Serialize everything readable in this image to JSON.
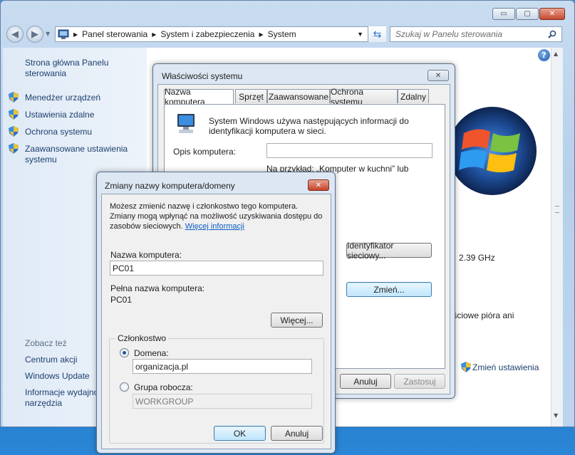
{
  "explorer": {
    "title_buttons": {
      "minimize": "▭",
      "maximize": "▢",
      "close": "✕"
    },
    "breadcrumb": [
      "Panel sterowania",
      "System i zabezpieczenia",
      "System"
    ],
    "search_placeholder": "Szukaj w Panelu sterowania",
    "left_pane": {
      "home_link": "Strona główna Panelu sterowania",
      "tasks": [
        "Menedżer urządzeń",
        "Ustawienia zdalne",
        "Ochrona systemu",
        "Zaawansowane ustawienia systemu"
      ],
      "see_also_heading": "Zobacz też",
      "see_also": [
        "Centrum akcji",
        "Windows Update",
        "Informacje wydajności i narzędzia"
      ]
    },
    "content_fragments": {
      "cpu_speed": "2.39 GHz",
      "pen_input": "ejściowe pióra ani",
      "change_settings": "Zmień ustawienia"
    }
  },
  "sysprops": {
    "title": "Właściwości systemu",
    "tabs": [
      "Nazwa komputera",
      "Sprzęt",
      "Zaawansowane",
      "Ochrona systemu",
      "Zdalny"
    ],
    "info_text": "System Windows używa następujących informacji do identyfikacji komputera w sieci.",
    "description_label": "Opis komputera:",
    "example_text": "Na przykład: „Komputer w kuchni” lub",
    "network_id_button": "Identyfikator sieciowy...",
    "change_button": "Zmień...",
    "cancel_button": "Anuluj",
    "apply_button": "Zastosuj"
  },
  "rename": {
    "title": "Zmiany nazwy komputera/domeny",
    "info_text": "Możesz zmienić nazwę i członkostwo tego komputera. Zmiany mogą wpłynąć na możliwość uzyskiwania dostępu do zasobów sieciowych.",
    "more_info_link": "Więcej informacji",
    "computer_name_label": "Nazwa komputera:",
    "computer_name_value": "PC01",
    "full_name_label": "Pełna nazwa komputera:",
    "full_name_value": "PC01",
    "more_button": "Więcej...",
    "membership_label": "Członkostwo",
    "domain_label": "Domena:",
    "domain_value": "organizacja.pl",
    "workgroup_label": "Grupa robocza:",
    "workgroup_value": "WORKGROUP",
    "ok_button": "OK",
    "cancel_button": "Anuluj"
  }
}
